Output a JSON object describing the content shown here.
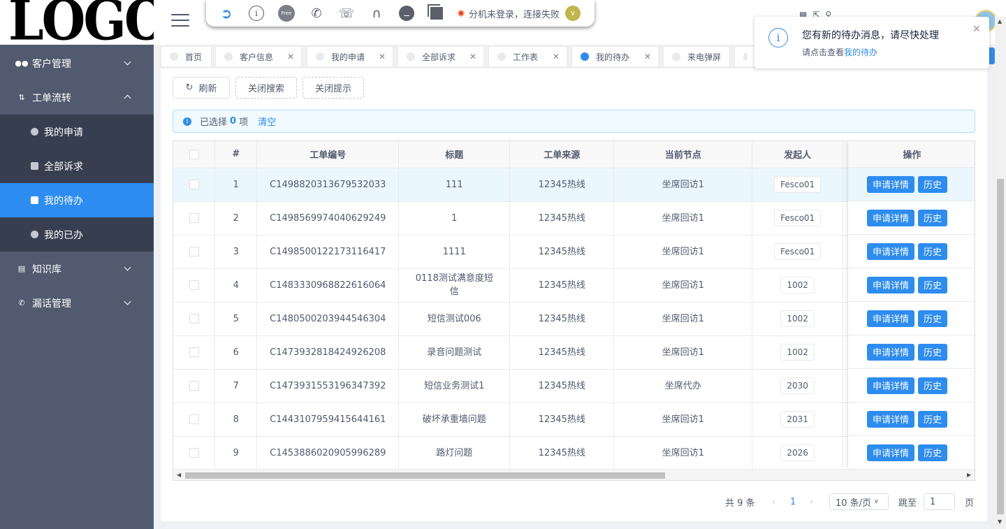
{
  "logo": "LOGO",
  "sidebar": {
    "menus": [
      {
        "label": "客户管理",
        "icon": "users-icon",
        "expanded": false
      },
      {
        "label": "工单流转",
        "icon": "flow-icon",
        "expanded": true
      },
      {
        "label": "知识库",
        "icon": "book-icon",
        "expanded": false
      },
      {
        "label": "漏话管理",
        "icon": "phone-icon",
        "expanded": false
      }
    ],
    "sub_items": [
      {
        "label": "我的申请",
        "icon": "dot-icon"
      },
      {
        "label": "全部诉求",
        "icon": "folder-icon"
      },
      {
        "label": "我的待办",
        "icon": "todo-icon",
        "active": true
      },
      {
        "label": "我的已办",
        "icon": "dot-icon"
      }
    ]
  },
  "toolbar": {
    "icons": [
      "login-icon",
      "info-icon",
      "free-icon",
      "phone-icon",
      "phone-hold-icon",
      "headset-icon",
      "hangup-icon",
      "copy-icon"
    ],
    "free_text": "Free",
    "status_text": "分机未登录，连接失败",
    "status_color": "#ed4014"
  },
  "tags": [
    {
      "label": "首页",
      "closable": false
    },
    {
      "label": "客户信息",
      "closable": true
    },
    {
      "label": "我的申请",
      "closable": true
    },
    {
      "label": "全部诉求",
      "closable": true
    },
    {
      "label": "工作表",
      "closable": true
    },
    {
      "label": "我的待办",
      "closable": true,
      "active": true
    },
    {
      "label": "来电弹屏",
      "closable": false
    }
  ],
  "notification": {
    "title": "您有新的待办消息，请尽快处理",
    "desc_prefix": "请点击查看",
    "link": "我的待办"
  },
  "buttons": {
    "refresh": "刷新",
    "close_search": "关闭搜索",
    "close_tip": "关闭提示"
  },
  "selection": {
    "prefix": "已选择",
    "count": "0",
    "suffix": "项",
    "clear": "清空"
  },
  "table": {
    "columns": [
      "#",
      "工单编号",
      "标题",
      "工单来源",
      "当前节点",
      "发起人",
      "操作"
    ],
    "rows": [
      {
        "no": "1",
        "code": "C1498820313679532033",
        "title": "111",
        "source": "12345热线",
        "node": "坐席回访1",
        "initiator": "Fesco01"
      },
      {
        "no": "2",
        "code": "C1498569974040629249",
        "title": "1",
        "source": "12345热线",
        "node": "坐席回访1",
        "initiator": "Fesco01"
      },
      {
        "no": "3",
        "code": "C1498500122173116417",
        "title": "1111",
        "source": "12345热线",
        "node": "坐席回访1",
        "initiator": "Fesco01"
      },
      {
        "no": "4",
        "code": "C1483330968822616064",
        "title": "0118测试满意度短信",
        "source": "12345热线",
        "node": "坐席回访1",
        "initiator": "1002"
      },
      {
        "no": "5",
        "code": "C1480500203944546304",
        "title": "短信测试006",
        "source": "12345热线",
        "node": "坐席回访1",
        "initiator": "1002"
      },
      {
        "no": "6",
        "code": "C1473932818424926208",
        "title": "录音问题测试",
        "source": "12345热线",
        "node": "坐席回访1",
        "initiator": "1002"
      },
      {
        "no": "7",
        "code": "C1473931553196347392",
        "title": "短信业务测试1",
        "source": "12345热线",
        "node": "坐席代办",
        "initiator": "2030"
      },
      {
        "no": "8",
        "code": "C1443107959415644161",
        "title": "破坏承重墙问题",
        "source": "12345热线",
        "node": "坐席回访1",
        "initiator": "2031"
      },
      {
        "no": "9",
        "code": "C1453886020905996289",
        "title": "路灯问题",
        "source": "12345热线",
        "node": "坐席回访1",
        "initiator": "2026"
      }
    ],
    "action_detail": "申请详情",
    "action_history": "历史"
  },
  "pager": {
    "total": "共 9 条",
    "current": "1",
    "page_size": "10 条/页",
    "jump_label": "跳至",
    "jump_value": "1",
    "page_unit": "页"
  },
  "colors": {
    "primary": "#2d8cf0",
    "sidebar": "#515a6e",
    "submenu": "#363e4f"
  }
}
